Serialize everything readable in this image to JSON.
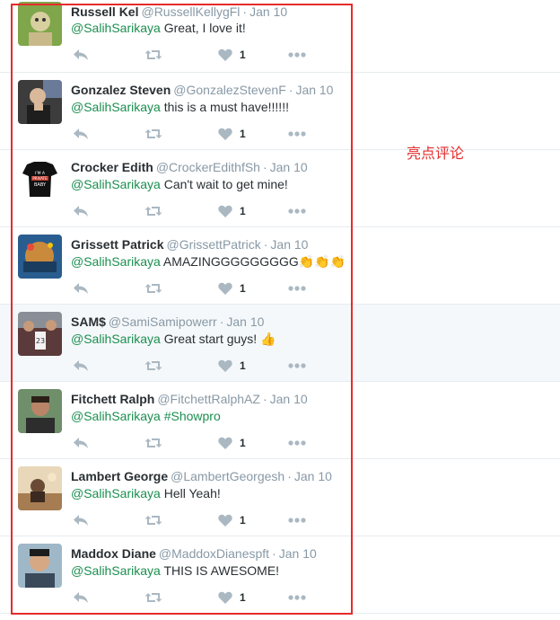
{
  "annotation": "亮点评论",
  "tweets": [
    {
      "name": "Russell Kel",
      "handle": "@RussellKellygFl",
      "time": "Jan 10",
      "mention": "@SalihSarikaya",
      "body": " Great, I love it!",
      "likes": "1"
    },
    {
      "name": "Gonzalez Steven",
      "handle": "@GonzalezStevenF",
      "time": "Jan 10",
      "mention": "@SalihSarikaya",
      "body": " this is a must have!!!!!!",
      "likes": "1"
    },
    {
      "name": "Crocker Edith",
      "handle": "@CrockerEdithfSh",
      "time": "Jan 10",
      "mention": "@SalihSarikaya",
      "body": " Can't wait to get mine!",
      "likes": "1"
    },
    {
      "name": "Grissett Patrick",
      "handle": "@GrissettPatrick",
      "time": "Jan 10",
      "mention": "@SalihSarikaya",
      "body": " AMAZINGGGGGGGGG👏👏👏",
      "likes": "1"
    },
    {
      "name": "SAM$",
      "handle": "@SamiSamipowerr",
      "time": "Jan 10",
      "mention": "@SalihSarikaya",
      "body": " Great start guys! 👍",
      "likes": "1"
    },
    {
      "name": "Fitchett Ralph",
      "handle": "@FitchettRalphAZ",
      "time": "Jan 10",
      "mention": "@SalihSarikaya",
      "body": "  #Showpro",
      "likes": "1"
    },
    {
      "name": "Lambert George",
      "handle": "@LambertGeorgesh",
      "time": "Jan 10",
      "mention": "@SalihSarikaya",
      "body": " Hell Yeah!",
      "likes": "1"
    },
    {
      "name": "Maddox Diane",
      "handle": "@MaddoxDianespft",
      "time": "Jan 10",
      "mention": "@SalihSarikaya",
      "body": " THIS IS AWESOME!",
      "likes": "1"
    }
  ],
  "colors": {
    "accent": "#1b8e50",
    "highlight_box": "#e52b2b",
    "muted": "#8899a6"
  }
}
